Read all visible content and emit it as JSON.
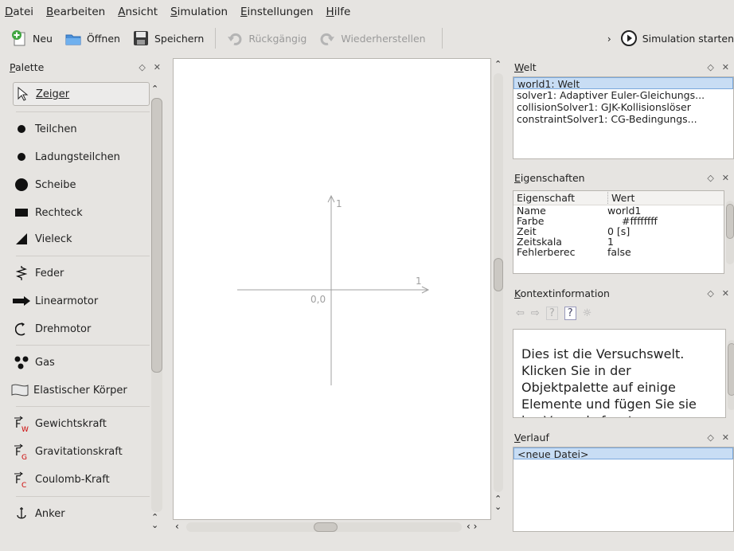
{
  "menu": [
    "Datei",
    "Bearbeiten",
    "Ansicht",
    "Simulation",
    "Einstellungen",
    "Hilfe"
  ],
  "toolbar": {
    "new_label": "Neu",
    "open_label": "Öffnen",
    "save_label": "Speichern",
    "undo_label": "Rückgängig",
    "redo_label": "Wiederherstellen",
    "overflow_label": "›",
    "run_label": "Simulation starten"
  },
  "palette": {
    "title": "Palette",
    "items": [
      {
        "label": "Zeiger",
        "icon": "pointer-icon"
      },
      {
        "label": "Teilchen",
        "icon": "particle-icon"
      },
      {
        "label": "Ladungsteilchen",
        "icon": "charged-particle-icon"
      },
      {
        "label": "Scheibe",
        "icon": "disk-icon"
      },
      {
        "label": "Rechteck",
        "icon": "rectangle-icon"
      },
      {
        "label": "Vieleck",
        "icon": "polygon-icon"
      },
      {
        "label": "Feder",
        "icon": "spring-icon"
      },
      {
        "label": "Linearmotor",
        "icon": "linear-motor-icon"
      },
      {
        "label": "Drehmotor",
        "icon": "rotation-motor-icon"
      },
      {
        "label": "Gas",
        "icon": "gas-icon"
      },
      {
        "label": "Elastischer Körper",
        "icon": "soft-body-icon"
      },
      {
        "label": "Gewichtskraft",
        "icon": "weight-force-icon",
        "sub": "W"
      },
      {
        "label": "Gravitationskraft",
        "icon": "gravitation-force-icon",
        "sub": "G"
      },
      {
        "label": "Coulomb-Kraft",
        "icon": "coulomb-force-icon",
        "sub": "C"
      },
      {
        "label": "Anker",
        "icon": "anchor-icon"
      }
    ]
  },
  "canvas": {
    "axis_x_label": "1",
    "axis_y_label": "1",
    "origin_label": "0,0"
  },
  "world": {
    "title": "Welt",
    "items": [
      "world1: Welt",
      "solver1: Adaptiver Euler-Gleichungs...",
      "collisionSolver1: GJK-Kollisionslöser",
      "constraintSolver1: CG-Bedingungs..."
    ]
  },
  "properties": {
    "title": "Eigenschaften",
    "col_property": "Eigenschaft",
    "col_value": "Wert",
    "rows": [
      {
        "key": "Name",
        "value": "world1"
      },
      {
        "key": "Farbe",
        "value": "#ffffffff"
      },
      {
        "key": "Zeit",
        "value": "0 [s]"
      },
      {
        "key": "Zeitskala",
        "value": "1"
      },
      {
        "key": "Fehlerberec",
        "value": "false"
      }
    ]
  },
  "context": {
    "title": "Kontextinformation",
    "text": "Dies ist die Versuchswelt. Klicken Sie in der Objektpalette auf einige Elemente und fügen Sie sie ins Versuchsfenster"
  },
  "history": {
    "title": "Verlauf",
    "items": [
      "<neue Datei>"
    ]
  },
  "colors": {
    "selection": "#c8ddf4",
    "selection_border": "#7aa8dc",
    "window_bg": "#e6e4e1",
    "force_subscript": "#cc0000"
  }
}
